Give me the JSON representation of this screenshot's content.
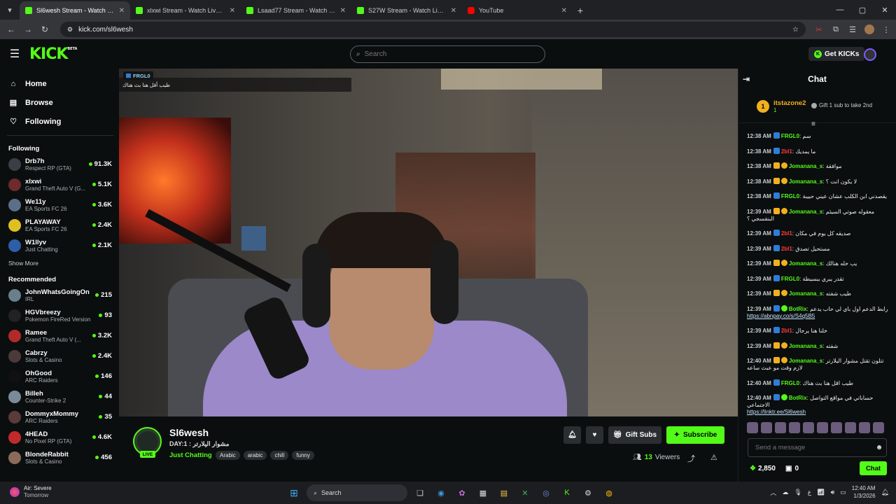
{
  "browser": {
    "tabs": [
      {
        "title": "Sl6wesh Stream - Watch Live on Kick",
        "active": true,
        "favicon": "kick"
      },
      {
        "title": "xlxwi Stream - Watch Live on Kick",
        "active": false,
        "favicon": "kick"
      },
      {
        "title": "Lsaad77 Stream - Watch Live on Kick",
        "active": false,
        "favicon": "kick"
      },
      {
        "title": "S27W Stream - Watch Live on Kick",
        "active": false,
        "favicon": "kick"
      },
      {
        "title": "YouTube",
        "active": false,
        "favicon": "youtube"
      }
    ],
    "url": "kick.com/sl6wesh"
  },
  "nav": {
    "logo": "KICK",
    "logo_badge": "BETA",
    "search_placeholder": "Search",
    "get_kicks_label": "Get KICKs"
  },
  "sidebar": {
    "nav": [
      {
        "label": "Home",
        "icon": "home-icon"
      },
      {
        "label": "Browse",
        "icon": "browse-icon"
      },
      {
        "label": "Following",
        "icon": "heart-icon"
      }
    ],
    "following_title": "Following",
    "following": [
      {
        "name": "Drb7h",
        "category": "Respect RP (GTA)",
        "viewers": "91.3K",
        "color": "#3a3f45"
      },
      {
        "name": "xlxwi",
        "category": "Grand Theft Auto V (G...",
        "viewers": "5.1K",
        "color": "#6d2b2b"
      },
      {
        "name": "We11y",
        "category": "EA Sports FC 26",
        "viewers": "3.6K",
        "color": "#5b6f8a"
      },
      {
        "name": "PLAYAWAY",
        "category": "EA Sports FC 26",
        "viewers": "2.4K",
        "color": "#e0c020"
      },
      {
        "name": "W1llyv",
        "category": "Just Chatting",
        "viewers": "2.1K",
        "color": "#2d5fa8"
      }
    ],
    "show_more": "Show More",
    "recommended_title": "Recommended",
    "recommended": [
      {
        "name": "JohnWhatsGoingOn",
        "category": "IRL",
        "viewers": "215",
        "color": "#6a7f8c"
      },
      {
        "name": "HGVbreezy",
        "category": "Pokemon FireRed Version",
        "viewers": "93",
        "color": "#222"
      },
      {
        "name": "Ramee",
        "category": "Grand Theft Auto V (...",
        "viewers": "3.2K",
        "color": "#b02a2a"
      },
      {
        "name": "Cabrzy",
        "category": "Slots & Casino",
        "viewers": "2.4K",
        "color": "#4c3a3a"
      },
      {
        "name": "OhGood",
        "category": "ARC Raiders",
        "viewers": "146",
        "color": "#111"
      },
      {
        "name": "Billeh",
        "category": "Counter-Strike 2",
        "viewers": "44",
        "color": "#7b8a99"
      },
      {
        "name": "DommyxMommy",
        "category": "ARC Raiders",
        "viewers": "35",
        "color": "#5a3a3a"
      },
      {
        "name": "4HEAD",
        "category": "No Pixel RP (GTA)",
        "viewers": "4.6K",
        "color": "#c02a2a"
      },
      {
        "name": "BlondeRabbit",
        "category": "Slots & Casino",
        "viewers": "456",
        "color": "#8a6b5a"
      }
    ]
  },
  "video": {
    "overlay_user": "FRGL0",
    "overlay_msg": "طيب أقل هنا بث هناك"
  },
  "stream": {
    "channel": "Sl6wesh",
    "live_label": "LIVE",
    "title": "DAY:1 : مشوار اليلارتر",
    "category": "Just Chatting",
    "tags": [
      "Arabic",
      "arabic",
      "chill",
      "funny"
    ],
    "gift_subs_label": "Gift Subs",
    "subscribe_label": "Subscribe",
    "viewers_count": "13",
    "viewers_label": "Viewers"
  },
  "chat": {
    "title": "Chat",
    "pinned_rank": "1",
    "pinned_user": "itstazone2",
    "pinned_count": "1",
    "pinned_note": "Gift 1 sub to take 2nd",
    "messages": [
      {
        "time": "12:38 AM",
        "user": "FRGL0",
        "color": "#53fc18",
        "text": "سم",
        "link": ""
      },
      {
        "time": "12:38 AM",
        "user": "2bl1",
        "color": "#ff3b3b",
        "text": "ما يمديك",
        "link": ""
      },
      {
        "time": "12:38 AM",
        "user": "Jomanana_s",
        "color": "#53fc18",
        "text": "موافقة",
        "link": ""
      },
      {
        "time": "12:38 AM",
        "user": "Jomanana_s",
        "color": "#53fc18",
        "text": "لا يكون انت ؟",
        "link": ""
      },
      {
        "time": "12:38 AM",
        "user": "FRGL0",
        "color": "#53fc18",
        "text": "يقصدني ابن الكلب عشان عيني حبيبة",
        "link": ""
      },
      {
        "time": "12:39 AM",
        "user": "Jomanana_s",
        "color": "#53fc18",
        "text": "معقوله صوتي السيئم البنفسجي ؟",
        "link": ""
      },
      {
        "time": "12:39 AM",
        "user": "2bl1",
        "color": "#ff3b3b",
        "text": "صديقه كل يوم في مكان",
        "link": ""
      },
      {
        "time": "12:39 AM",
        "user": "2bl1",
        "color": "#ff3b3b",
        "text": "مستحيل تصدق",
        "link": ""
      },
      {
        "time": "12:39 AM",
        "user": "Jomanana_s",
        "color": "#53fc18",
        "text": "يب خله هنالك",
        "link": ""
      },
      {
        "time": "12:39 AM",
        "user": "FRGL0",
        "color": "#53fc18",
        "text": "تقدر يبري ببسيطة",
        "link": ""
      },
      {
        "time": "12:39 AM",
        "user": "Jomanana_s",
        "color": "#53fc18",
        "text": "طيب شفته",
        "link": ""
      },
      {
        "time": "12:39 AM",
        "user": "BotRix",
        "color": "#53fc18",
        "text": "رابط الدعم اول باي لي حاب يدعم",
        "link": "https://abnpay.co/s/S4q5B5"
      },
      {
        "time": "12:39 AM",
        "user": "2bl1",
        "color": "#ff3b3b",
        "text": "خلنا هنا يرجال",
        "link": ""
      },
      {
        "time": "12:39 AM",
        "user": "Jomanana_s",
        "color": "#53fc18",
        "text": "شفته",
        "link": ""
      },
      {
        "time": "12:40 AM",
        "user": "Jomanana_s",
        "color": "#53fc18",
        "text": "تتلون تقتل مشوار اليلارتر لازم وقت مو عبث ساعه",
        "link": ""
      },
      {
        "time": "12:40 AM",
        "user": "FRGL0",
        "color": "#53fc18",
        "text": "طيب اقل هنا بث هناك",
        "link": ""
      },
      {
        "time": "12:40 AM",
        "user": "BotRix",
        "color": "#53fc18",
        "text": "حساباتي في مواقع التواصل الاجتماعي",
        "link": "https://linktr.ee/Sl6wesh"
      }
    ],
    "input_placeholder": "Send a message",
    "kicks_balance": "2,850",
    "subs_count": "0",
    "send_label": "Chat"
  },
  "taskbar": {
    "weather_title": "Air: Severe",
    "weather_sub": "Tomorrow",
    "search_label": "Search",
    "time": "12:40 AM",
    "date": "1/3/2026"
  }
}
